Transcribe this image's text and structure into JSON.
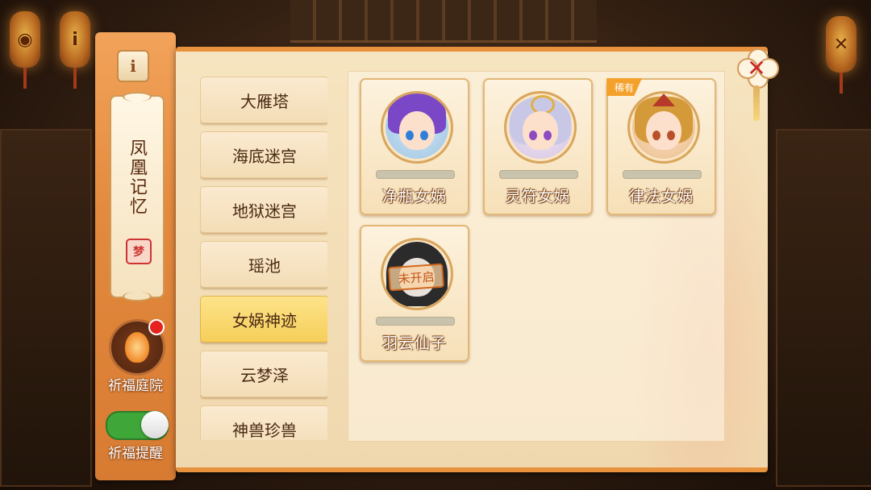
{
  "left_panel": {
    "info_icon": "info-icon",
    "scroll_title": "凤凰记忆",
    "dream_badge": "梦",
    "courtyard_label": "祈福庭院",
    "reminder_label": "祈福提醒",
    "reminder_on": true
  },
  "menu": {
    "items": [
      {
        "label": "大雁塔"
      },
      {
        "label": "海底迷宫"
      },
      {
        "label": "地狱迷宫"
      },
      {
        "label": "瑶池"
      },
      {
        "label": "女娲神迹"
      },
      {
        "label": "云梦泽"
      },
      {
        "label": "神兽珍兽"
      }
    ],
    "selected": "女娲神迹"
  },
  "cards": [
    {
      "name": "净瓶女娲",
      "hair": "#7a48c6",
      "eyes": "#2f7fd8"
    },
    {
      "name": "灵符女娲",
      "hair": "#c8c8e6",
      "eyes": "#8e4bbf"
    },
    {
      "name": "律法女娲",
      "hair": "#d49a3a",
      "eyes": "#b8502a",
      "badge": "稀有"
    },
    {
      "name": "羽云仙子",
      "hair": "#2b2b2b",
      "eyes": "#444444",
      "locked": "未开启"
    }
  ],
  "colors": {
    "accent_orange": "#e8923e",
    "selected_menu": "#f6cf5a",
    "toggle_on": "#3fa63a",
    "close_x": "#c92a2a"
  }
}
